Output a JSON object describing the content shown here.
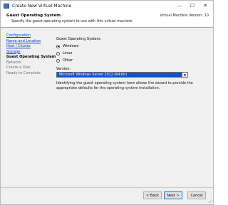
{
  "window": {
    "title": "Create New Virtual Machine",
    "controls": {
      "minimize": "—",
      "maximize": "☐",
      "close": "✕"
    }
  },
  "header": {
    "title": "Guest Operating System",
    "subtitle": "Specify the guest operating system to use with this virtual machine",
    "version": "Virtual Machine Version: 10"
  },
  "sidebar": {
    "items": [
      {
        "label": "Configuration",
        "state": "link"
      },
      {
        "label": "Name and Location",
        "state": "link"
      },
      {
        "label": "Host / Cluster",
        "state": "link"
      },
      {
        "label": "Storage",
        "state": "link"
      },
      {
        "label": "Guest Operating System",
        "state": "current"
      },
      {
        "label": "Network",
        "state": "pending"
      },
      {
        "label": "Create a Disk",
        "state": "pending"
      },
      {
        "label": "Ready to Complete",
        "state": "pending"
      }
    ]
  },
  "main": {
    "os_label": "Guest Operating System:",
    "os_options": [
      {
        "label": "Windows",
        "checked": true
      },
      {
        "label": "Linux",
        "checked": false
      },
      {
        "label": "Other",
        "checked": false
      }
    ],
    "version_label": "Version:",
    "version_value": "Microsoft Windows Server 2012 (64-bit)",
    "description": "Identifying the guest operating system here allows the wizard to provide the appropriate defaults for the operating system installation."
  },
  "footer": {
    "back_label": "< Back",
    "next_label": "Next >",
    "cancel_label": "Cancel"
  },
  "colors": {
    "link": "#0a36c9",
    "selection": "#0a53c8",
    "dialog_bg": "#f0f0f0"
  }
}
